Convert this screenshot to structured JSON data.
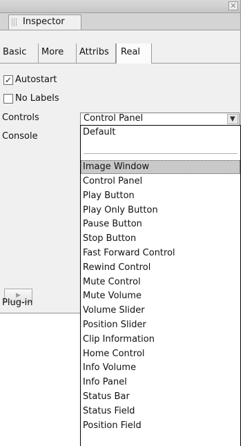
{
  "panel": {
    "close_glyph": "✕",
    "tab_label": "Inspector"
  },
  "tabs": [
    "Basic",
    "More",
    "Attribs",
    "Real"
  ],
  "checkboxes": [
    {
      "label": "Autostart",
      "checked": true,
      "mark": "✓"
    },
    {
      "label": "No Labels",
      "checked": false,
      "mark": ""
    }
  ],
  "fields": {
    "controls_label": "Controls",
    "controls_value": "Control Panel",
    "console_label": "Console",
    "plugin_label": "Plug-in"
  },
  "play_glyph": "▶",
  "dropdown": {
    "first_option": "Default",
    "selected_option": "Image Window",
    "options": [
      "Control Panel",
      "Play Button",
      "Play Only Button",
      "Pause Button",
      "Stop Button",
      "Fast Forward Control",
      "Rewind Control",
      "Mute Control",
      "Mute Volume",
      "Volume Slider",
      "Position Slider",
      "Clip Information",
      "Home Control",
      "Info Volume",
      "Info Panel",
      "Status Bar",
      "Status Field",
      "Position Field"
    ]
  },
  "colors": {
    "panel_bg": "#f0f0f0",
    "selected_option_bg": "#c9c9c9"
  }
}
